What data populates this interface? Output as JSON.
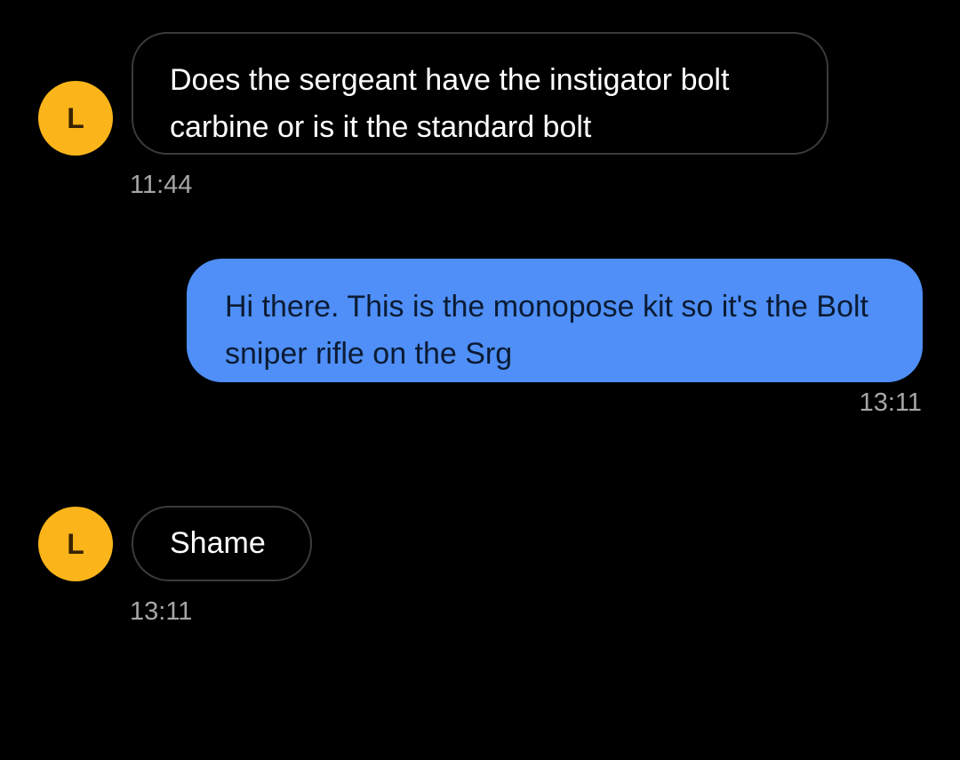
{
  "messages": [
    {
      "direction": "incoming",
      "avatar_initial": "L",
      "text": "Does the sergeant have the instigator bolt carbine or is it the standard bolt",
      "time": "11:44"
    },
    {
      "direction": "outgoing",
      "text": "Hi there. This is the monopose kit so it's the Bolt sniper rifle on the Srg",
      "time": "13:11"
    },
    {
      "direction": "incoming",
      "avatar_initial": "L",
      "text": "Shame",
      "time": "13:11"
    }
  ],
  "colors": {
    "background": "#000000",
    "avatar": "#fbb51a",
    "outgoing_bubble": "#4f8ff7",
    "incoming_border": "#3b3b3b",
    "timestamp": "#a6a6a6"
  }
}
